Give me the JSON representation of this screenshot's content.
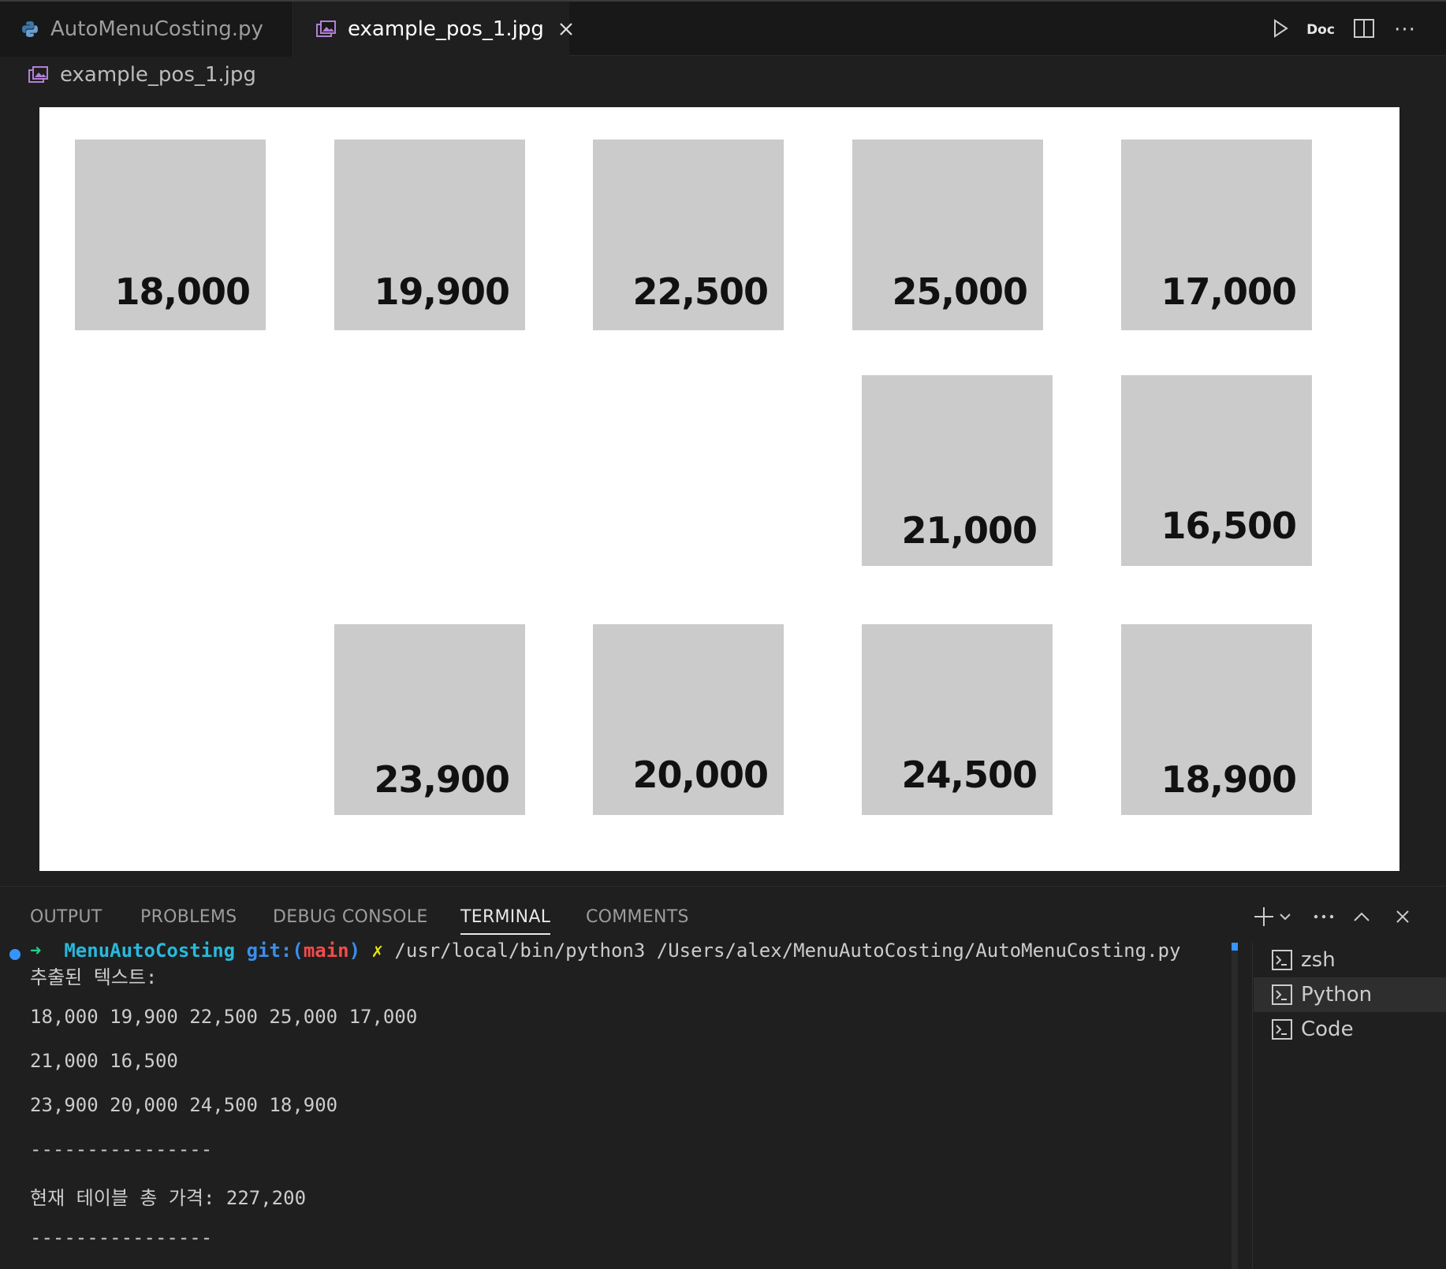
{
  "tabs": [
    {
      "label": "AutoMenuCosting.py",
      "icon": "python-icon",
      "active": false
    },
    {
      "label": "example_pos_1.jpg",
      "icon": "image-icon",
      "active": true
    }
  ],
  "editor_actions": {
    "run_icon": "play-icon",
    "doc_label": "Doc",
    "split_icon": "split-editor-icon",
    "more_label": "···"
  },
  "breadcrumb": {
    "label": "example_pos_1.jpg",
    "icon": "image-icon"
  },
  "preview": {
    "background": "#ffffff",
    "card_color": "#cbcbcb",
    "rows": [
      [
        "18,000",
        "19,900",
        "22,500",
        "25,000",
        "17,000"
      ],
      [
        "21,000",
        "16,500"
      ],
      [
        "23,900",
        "20,000",
        "24,500",
        "18,900"
      ]
    ]
  },
  "panel": {
    "tabs": [
      "OUTPUT",
      "PROBLEMS",
      "DEBUG CONSOLE",
      "TERMINAL",
      "COMMENTS"
    ],
    "active_tab": "TERMINAL",
    "actions": [
      "add-terminal-icon",
      "chevron-down-icon",
      "more-icon",
      "maximize-panel-icon",
      "close-icon"
    ]
  },
  "terminal": {
    "prompt": {
      "arrow": "➜",
      "dir": "MenuAutoCosting",
      "git_label": "git:(",
      "branch": "main",
      "git_close": ")",
      "dirty": "✗",
      "command": "/usr/local/bin/python3 /Users/alex/MenuAutoCosting/AutoMenuCosting.py"
    },
    "lines": [
      "추출된 텍스트:",
      "",
      "18,000 19,900 22,500 25,000 17,000",
      "",
      "21,000 16,500",
      "",
      "23,900 20,000 24,500 18,900",
      "",
      "----------------",
      "",
      "현재 테이블 총 가격: 227,200",
      "",
      "----------------"
    ],
    "colors": {
      "arrow": "#23d18b",
      "dir": "#29b8db",
      "git": "#3b8eea",
      "branch": "#f14c4c",
      "dirty": "#e5e510"
    }
  },
  "terminal_list": [
    {
      "label": "zsh",
      "selected": false
    },
    {
      "label": "Python",
      "selected": true
    },
    {
      "label": "Code",
      "selected": false
    }
  ]
}
